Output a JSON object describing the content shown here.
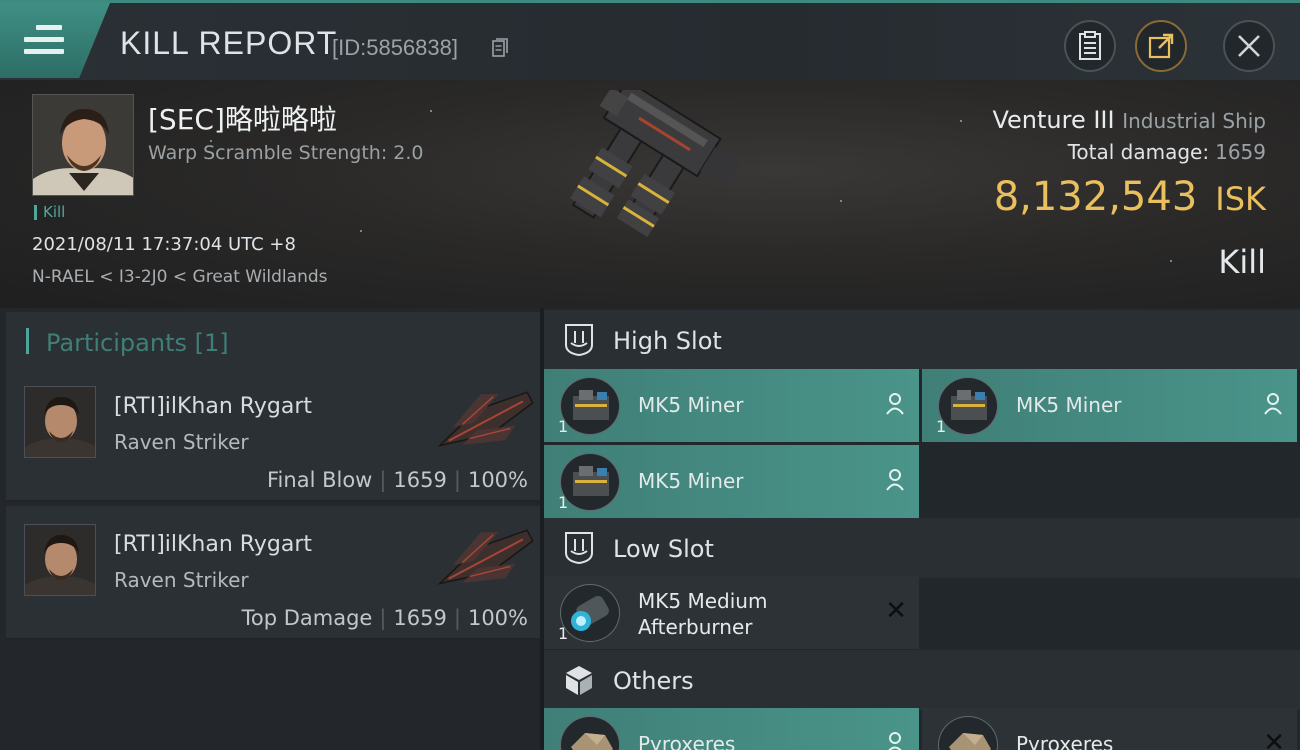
{
  "topbar": {
    "title": "KILL REPORT",
    "report_id": "[ID:5856838]",
    "icons": [
      "menu-icon",
      "clipboard-icon",
      "share-icon",
      "close-icon"
    ]
  },
  "victim": {
    "name": "[SEC]略啦略啦",
    "scramble": "Warp Scramble Strength: 2.0",
    "tag": "Kill",
    "datetime": "2021/08/11 17:37:04 UTC +8",
    "location": "N-RAEL < I3-2J0 < Great Wildlands",
    "ship_name": "Venture III",
    "ship_class": "Industrial Ship",
    "total_damage_label": "Total damage:",
    "total_damage": "1659",
    "isk_value": "8,132,543",
    "isk_unit": "ISK",
    "result": "Kill"
  },
  "participants": {
    "header": "Participants [1]",
    "rows": [
      {
        "name": "[RTI]ilKhan Rygart",
        "ship": "Raven Striker",
        "role": "Final Blow",
        "damage": "1659",
        "percent": "100%"
      },
      {
        "name": "[RTI]ilKhan Rygart",
        "ship": "Raven Striker",
        "role": "Top Damage",
        "damage": "1659",
        "percent": "100%"
      }
    ]
  },
  "slots": {
    "high": {
      "label": "High Slot",
      "modules": [
        {
          "name": "MK5 Miner",
          "qty": "1"
        },
        {
          "name": "MK5 Miner",
          "qty": "1"
        },
        {
          "name": "MK5 Miner",
          "qty": "1"
        }
      ]
    },
    "low": {
      "label": "Low Slot",
      "modules": [
        {
          "name_line1": "MK5 Medium",
          "name_line2": "Afterburner",
          "qty": "1"
        }
      ]
    },
    "others": {
      "label": "Others",
      "modules": [
        {
          "name": "Pyroxeres"
        },
        {
          "name": "Pyroxeres"
        }
      ]
    }
  },
  "colors": {
    "accent": "#4fa79b",
    "isk": "#e9c05d",
    "module_fill": "#4a948a"
  }
}
